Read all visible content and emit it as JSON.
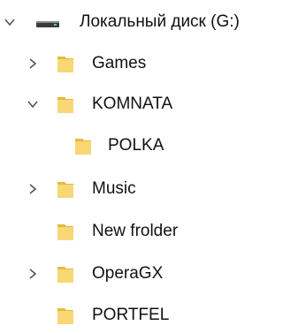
{
  "tree": {
    "drive": {
      "label": "Локальный диск (G:)",
      "expanded": true,
      "icon": "drive-icon"
    },
    "items": [
      {
        "label": "Games",
        "has_children": true,
        "expanded": false,
        "icon": "folder-icon"
      },
      {
        "label": "KOMNATA",
        "has_children": true,
        "expanded": true,
        "icon": "folder-icon",
        "children": [
          {
            "label": "POLKA",
            "icon": "folder-icon"
          }
        ]
      },
      {
        "label": "Music",
        "has_children": true,
        "expanded": false,
        "icon": "folder-icon"
      },
      {
        "label": "New frolder",
        "has_children": false,
        "icon": "folder-icon"
      },
      {
        "label": "OperaGX",
        "has_children": true,
        "expanded": false,
        "icon": "folder-icon"
      },
      {
        "label": "PORTFEL",
        "has_children": false,
        "icon": "folder-icon"
      }
    ],
    "colors": {
      "folder": "#f8d775",
      "folder_dark": "#e6b93a",
      "chevron": "#555555"
    }
  }
}
